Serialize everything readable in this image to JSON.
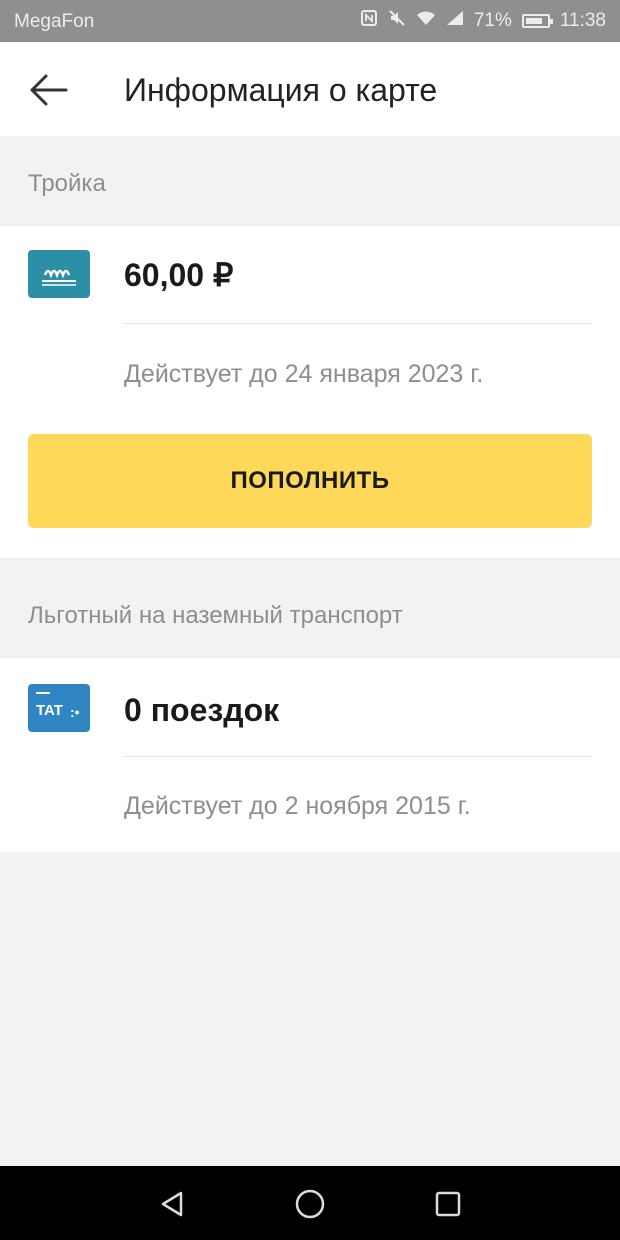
{
  "status_bar": {
    "carrier": "MegaFon",
    "battery": "71%",
    "time": "11:38",
    "icons": [
      "nfc-icon",
      "mute-icon",
      "wifi-icon",
      "signal-icon",
      "battery-icon"
    ]
  },
  "header": {
    "title": "Информация о карте",
    "back_icon": "arrow-left-icon"
  },
  "troika": {
    "section_label": "Тройка",
    "balance": "60,00 ₽",
    "valid_until": "Действует до 24 января 2023 г.",
    "topup_label": "ПОПОЛНИТЬ",
    "icon": "troika-card-icon",
    "icon_color": "#2b8fa8",
    "button_color": "#fed859"
  },
  "benefit": {
    "section_label": "Льготный на наземный транспорт",
    "trips": "0 поездок",
    "valid_until": "Действует до 2 ноября 2015 г.",
    "icon": "transport-card-icon",
    "icon_text": "TAT",
    "icon_color": "#2f86c3"
  },
  "nav_bar": {
    "icons": [
      "back-triangle-icon",
      "home-circle-icon",
      "recents-square-icon"
    ]
  }
}
